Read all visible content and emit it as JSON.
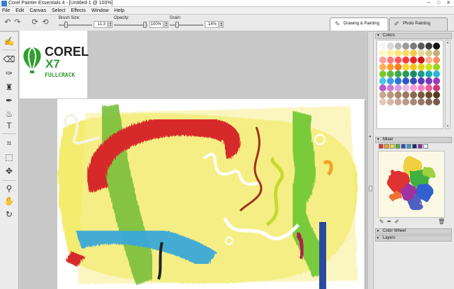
{
  "window": {
    "title": "Corel Painter Essentials 4 - [Untitled-1 @ 100%]",
    "minimize": "─",
    "maximize": "□",
    "close": "✕"
  },
  "menu": [
    "File",
    "Edit",
    "Canvas",
    "Select",
    "Effects",
    "Window",
    "Help"
  ],
  "property_bar": {
    "brush_size_label": "Brush Size:",
    "brush_size_value": "11.3",
    "opacity_label": "Opacity:",
    "opacity_value": "100%",
    "grain_label": "Grain:",
    "grain_value": "14%"
  },
  "workspace_tabs": [
    {
      "label": "Drawing & Painting",
      "active": true
    },
    {
      "label": "Photo Painting",
      "active": false
    }
  ],
  "watermark": {
    "brand": "COREL",
    "version": "X7",
    "tag": "FULLCRACK"
  },
  "panels": {
    "colors_title": "Colors",
    "mixer_title": "Mixer",
    "color_wheel_title": "Color Wheel",
    "layers_title": "Layers",
    "color_swatches": [
      "#f6f6f6",
      "#d9d9d9",
      "#b8b8b8",
      "#9a9a9a",
      "#7a7a7a",
      "#5a5a5a",
      "#3a3a3a",
      "#111111",
      "#fff7c8",
      "#fff09a",
      "#ffe57a",
      "#ffd860",
      "#f5c847",
      "#e8d89a",
      "#d8c88a",
      "#c0b078",
      "#ff9c9c",
      "#ff7a7a",
      "#ff5858",
      "#ff3a3a",
      "#e82424",
      "#c81818",
      "#ffb089",
      "#ff8c5a",
      "#ffb05a",
      "#ff9a2a",
      "#f57c1a",
      "#ffd22a",
      "#f5c21a",
      "#e6d21a",
      "#c8e61a",
      "#9ad21a",
      "#7ac82a",
      "#5ab83a",
      "#3aa84a",
      "#2a985a",
      "#1a886a",
      "#1a9a8a",
      "#1aaab0",
      "#2ab8d2",
      "#4ac8e6",
      "#3a9ae6",
      "#2a7ad2",
      "#2a5ac8",
      "#3a4ab8",
      "#5a3ab8",
      "#7a3ab8",
      "#9a3ab8",
      "#b85ac8",
      "#c87ad2",
      "#d89ae0",
      "#e6b8ea",
      "#ff9ad2",
      "#ff7ab8",
      "#e85a9a",
      "#c83a7a",
      "#c8a88a",
      "#b8987a",
      "#a8886a",
      "#98785a",
      "#88684a",
      "#785a3a",
      "#684a2a",
      "#583a1a",
      "#e8c8b8",
      "#d8b8a8",
      "#c8a898",
      "#b89888",
      "#a88878",
      "#987868",
      "#886858",
      "#785848"
    ],
    "mixer_swatches": [
      "#e83030",
      "#f0a030",
      "#f0e030",
      "#50b040",
      "#3050c0",
      "#30a0c0",
      "#1a2a6a",
      "#8a30a0",
      "#f0f0f0"
    ]
  }
}
